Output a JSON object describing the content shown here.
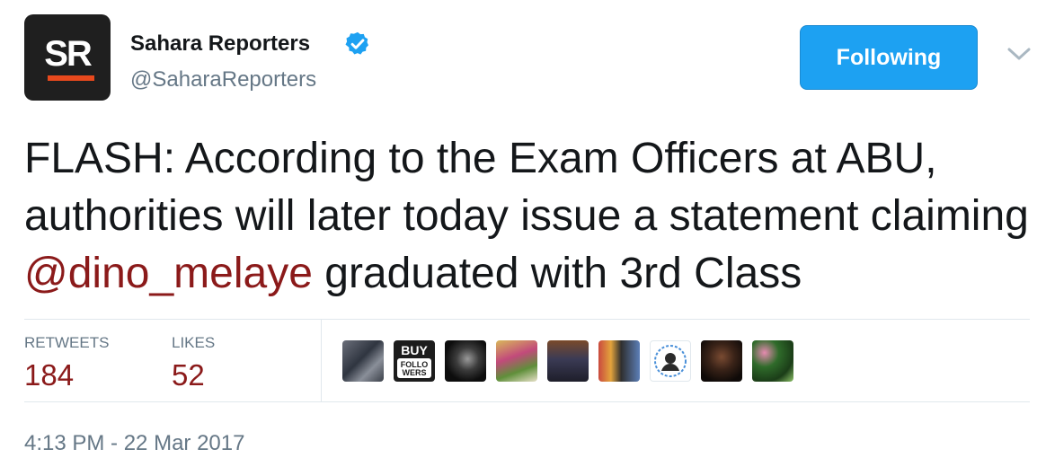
{
  "author": {
    "name": "Sahara Reporters",
    "handle": "@SaharaReporters",
    "avatar_text": "SR",
    "verified": true
  },
  "follow_button": {
    "label": "Following"
  },
  "tweet": {
    "text_before": "FLASH: According to the Exam Officers at ABU, authorities will later today issue a statement claiming ",
    "mention": "@dino_melaye",
    "text_after": " graduated with 3rd Class"
  },
  "stats": {
    "retweets_label": "RETWEETS",
    "retweets_count": "184",
    "likes_label": "LIKES",
    "likes_count": "52"
  },
  "likers": [
    {
      "name": "liker-1",
      "icon": "photo"
    },
    {
      "name": "liker-2",
      "icon": "buy-followers-logo",
      "text": "BUY FOLLO WERS"
    },
    {
      "name": "liker-3",
      "icon": "photo"
    },
    {
      "name": "liker-4",
      "icon": "photo"
    },
    {
      "name": "liker-5",
      "icon": "photo"
    },
    {
      "name": "liker-6",
      "icon": "photo"
    },
    {
      "name": "liker-7",
      "icon": "photo"
    },
    {
      "name": "liker-8",
      "icon": "photo"
    },
    {
      "name": "liker-9",
      "icon": "photo"
    },
    {
      "name": "liker-10",
      "icon": "photo"
    }
  ],
  "timestamp": "4:13 PM - 22 Mar 2017",
  "colors": {
    "follow_button": "#1da1f2",
    "verified_badge": "#1da1f2",
    "accent_text": "#8b1a1a",
    "muted_text": "#657786",
    "avatar_bar": "#e8491d"
  }
}
